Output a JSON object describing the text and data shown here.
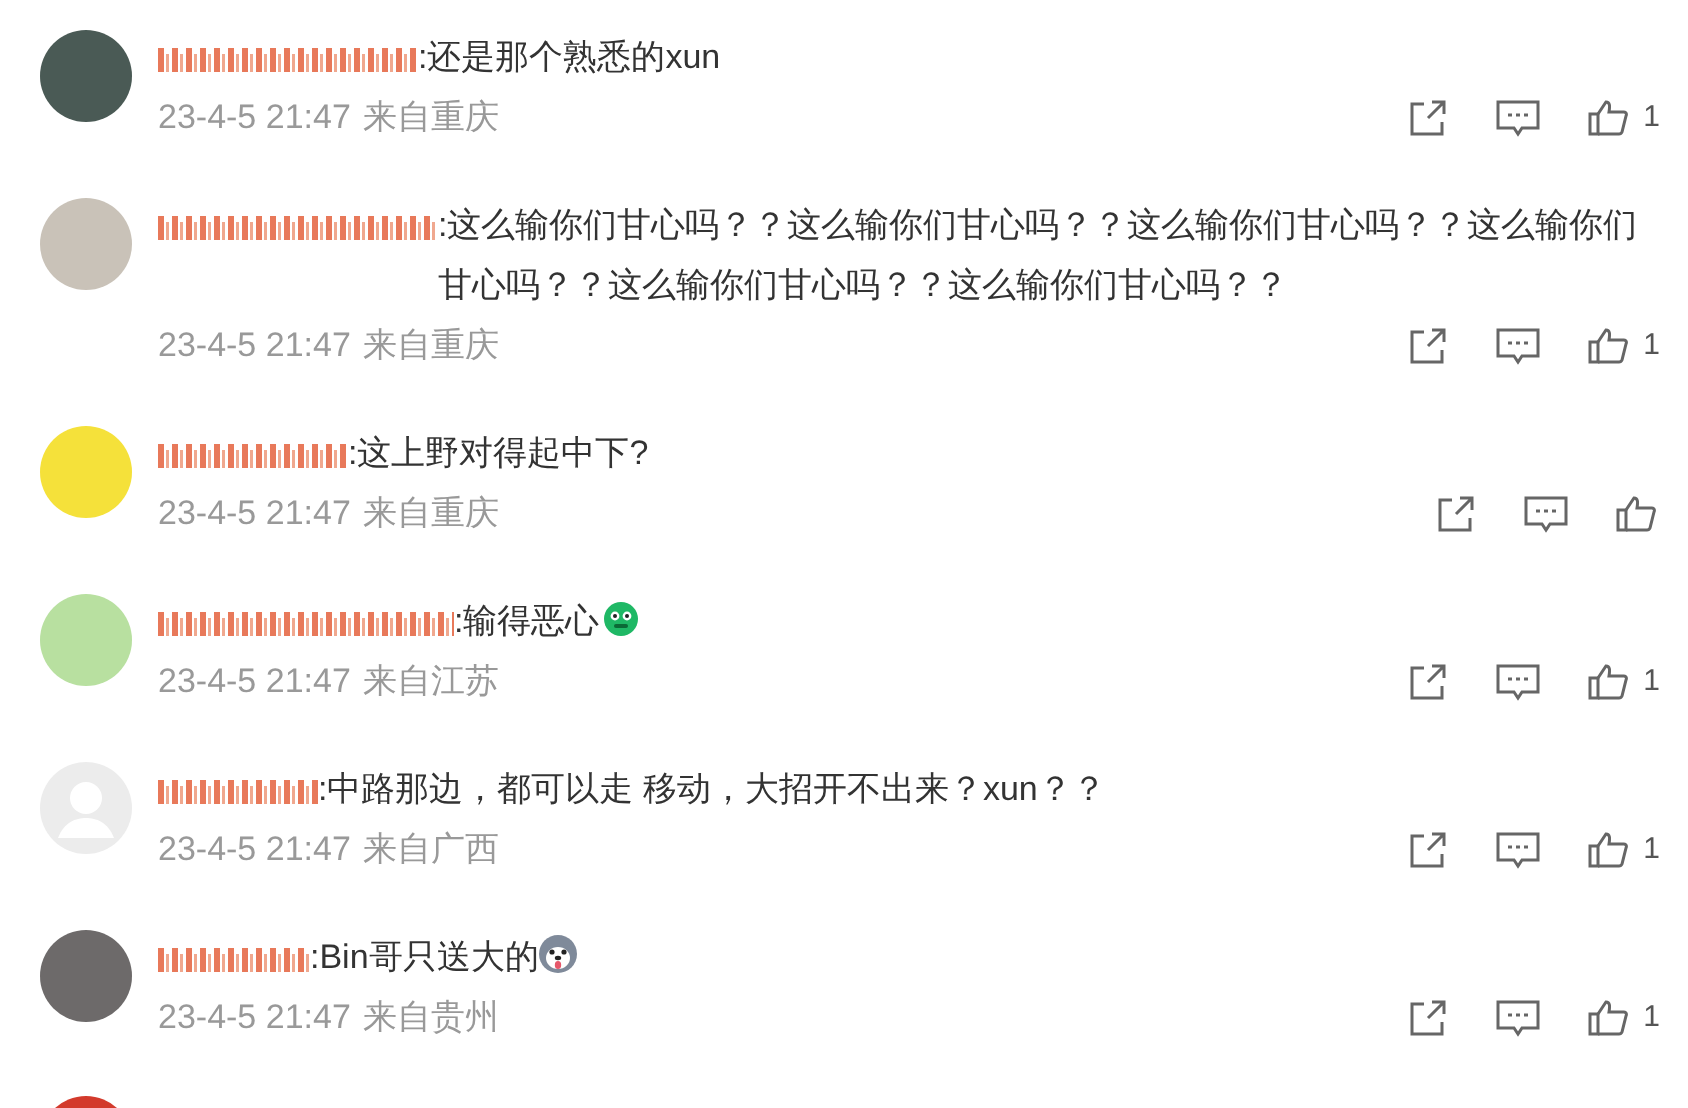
{
  "comments": [
    {
      "kind": "photo-avatar",
      "text": ":还是那个熟悉的xun",
      "time": "23-4-5 21:47",
      "location": "来自重庆",
      "likes": "1"
    },
    {
      "kind": "photo-avatar",
      "text": ":这么输你们甘心吗？？这么输你们甘心吗？？这么输你们甘心吗？？这么输你们甘心吗？？这么输你们甘心吗？？这么输你们甘心吗？？",
      "time": "23-4-5 21:47",
      "location": "来自重庆",
      "likes": "1"
    },
    {
      "kind": "photo-avatar",
      "text": ":这上野对得起中下?",
      "time": "23-4-5 21:47",
      "location": "来自重庆"
    },
    {
      "kind": "photo-avatar",
      "text": ":输得恶心",
      "sticker": {
        "kind": "green-face"
      },
      "time": "23-4-5 21:47",
      "location": "来自江苏",
      "likes": "1"
    },
    {
      "kind": "default-avatar",
      "text": ":中路那边，都可以走 移动，大招开不出来？xun？？",
      "time": "23-4-5 21:47",
      "location": "来自广西",
      "likes": "1"
    },
    {
      "kind": "photo-avatar",
      "text": ":Bin哥只送大的",
      "sticker": {
        "kind": "dog-face"
      },
      "time": "23-4-5 21:47",
      "location": "来自贵州",
      "likes": "1"
    }
  ]
}
